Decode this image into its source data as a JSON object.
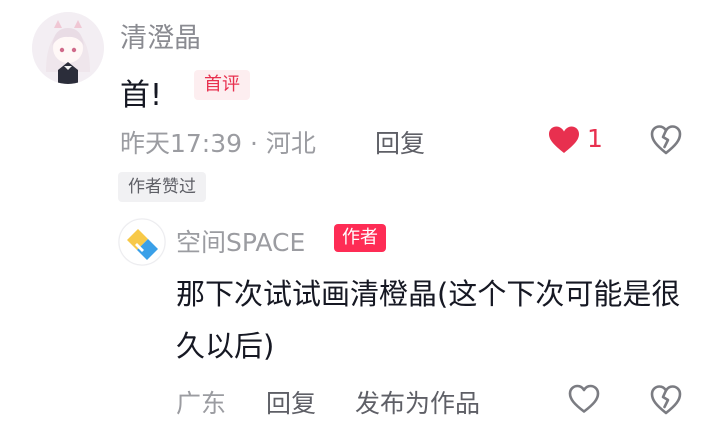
{
  "comment": {
    "username": "清澄晶",
    "content": "首!",
    "first_badge": "首评",
    "time_location": "昨天17:39 · 河北",
    "reply_label": "回复",
    "like_count": "1",
    "liked": true,
    "author_liked_label": "作者赞过"
  },
  "reply": {
    "username": "空间SPACE",
    "author_badge": "作者",
    "content": "那下次试试画清橙晶(这个下次可能是很久以后)",
    "location": "广东",
    "reply_label": "回复",
    "publish_label": "发布为作品",
    "liked": false
  },
  "colors": {
    "accent": "#fe2c55",
    "like_red": "#e8304f",
    "muted_text": "#9b9ca1"
  },
  "icons": [
    "avatar-anime-girl",
    "avatar-space-logo",
    "heart-icon",
    "dislike-broken-heart-icon"
  ]
}
